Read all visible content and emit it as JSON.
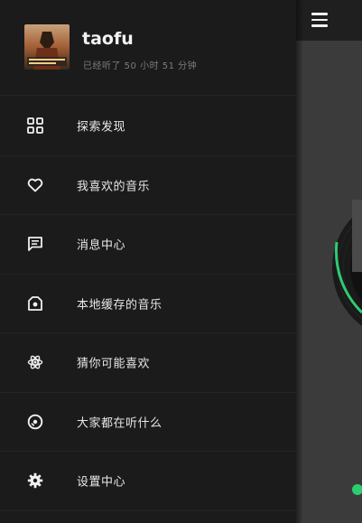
{
  "profile": {
    "username": "taofu",
    "listen_time": "已经听了 50 小时 51 分钟",
    "avatar": "user-avatar-image"
  },
  "menu": {
    "items": [
      {
        "label": "探索发现",
        "icon": "grid-icon"
      },
      {
        "label": "我喜欢的音乐",
        "icon": "heart-icon"
      },
      {
        "label": "消息中心",
        "icon": "message-icon"
      },
      {
        "label": "本地缓存的音乐",
        "icon": "local-cache-icon"
      },
      {
        "label": "猜你可能喜欢",
        "icon": "atom-icon"
      },
      {
        "label": "大家都在听什么",
        "icon": "disc-icon"
      },
      {
        "label": "设置中心",
        "icon": "settings-icon"
      }
    ]
  },
  "background": {
    "menu_icon": "hamburger-menu-icon",
    "accent_color": "#2ecc71"
  }
}
